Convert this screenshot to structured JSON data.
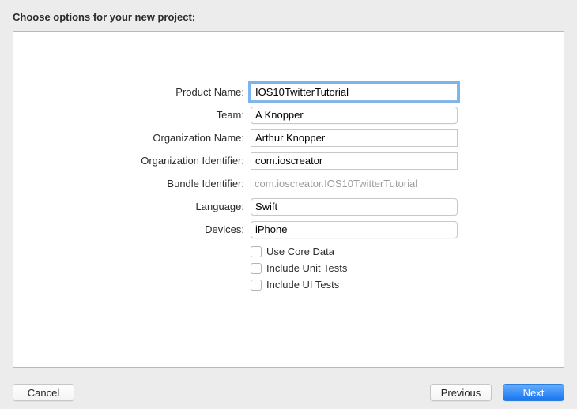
{
  "title": "Choose options for your new project:",
  "labels": {
    "productName": "Product Name:",
    "team": "Team:",
    "orgName": "Organization Name:",
    "orgIdent": "Organization Identifier:",
    "bundleIdent": "Bundle Identifier:",
    "language": "Language:",
    "devices": "Devices:"
  },
  "values": {
    "productName": "IOS10TwitterTutorial",
    "team": "A Knopper",
    "orgName": "Arthur Knopper",
    "orgIdent": "com.ioscreator",
    "bundleIdent": "com.ioscreator.IOS10TwitterTutorial",
    "language": "Swift",
    "devices": "iPhone"
  },
  "checks": {
    "coreData": "Use Core Data",
    "unitTests": "Include Unit Tests",
    "uiTests": "Include UI Tests"
  },
  "buttons": {
    "cancel": "Cancel",
    "previous": "Previous",
    "next": "Next"
  }
}
